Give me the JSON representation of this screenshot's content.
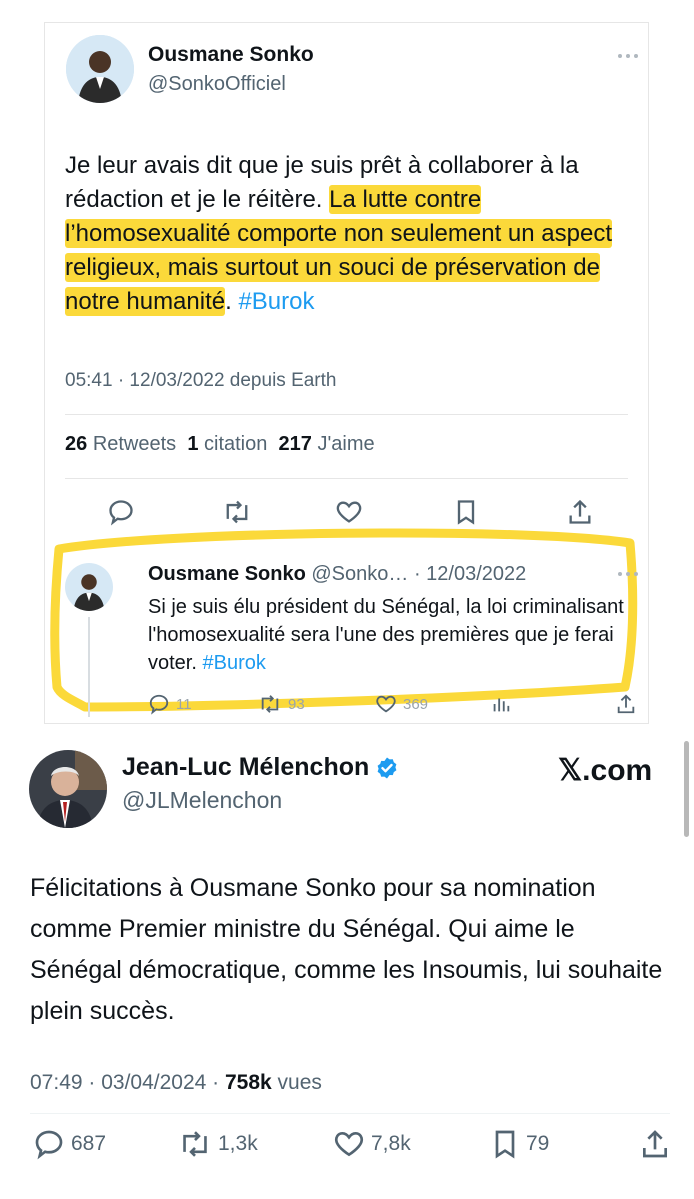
{
  "tweet1": {
    "author_name": "Ousmane Sonko",
    "author_handle": "@SonkoOfficiel",
    "text_part1": "Je leur avais dit que je suis prêt à collaborer à la rédaction et je le réitère. ",
    "text_highlight": "La lutte contre l’homosexualité comporte non seulement un aspect religieux, mais surtout un souci de préservation de notre humanité",
    "text_end": ". ",
    "hashtag": "#Burok",
    "timestamp": "05:41 · 12/03/2022 depuis Earth",
    "retweets_count": "26",
    "retweets_label": "Retweets",
    "quotes_count": "1",
    "quotes_label": "citation",
    "likes_count": "217",
    "likes_label": "J'aime"
  },
  "quoted_tweet": {
    "author_name": "Ousmane Sonko",
    "meta": "@Sonko… · 12/03/2022",
    "text": "Si je suis élu président du Sénégal, la loi criminalisant l'homosexualité sera l'une des premières que je ferai voter. ",
    "hashtag": "#Burok",
    "replies": "11",
    "retweets": "93",
    "likes": "369"
  },
  "tweet2": {
    "author_name": "Jean-Luc Mélenchon",
    "author_handle": "@JLMelenchon",
    "brand": "𝕏.com",
    "text": "Félicitations à Ousmane Sonko pour sa nomination comme Premier ministre du Sénégal. Qui aime le Sénégal démocratique, comme les Insoumis, lui souhaite plein succès.",
    "timestamp": "07:49 · 03/04/2024 · ",
    "views_count": "758k",
    "views_label": " vues",
    "replies": "687",
    "retweets": "1,3k",
    "likes": "7,8k",
    "bookmarks": "79"
  },
  "colors": {
    "highlight": "#fbd93a",
    "link": "#1d9bf0",
    "muted": "#536471",
    "verified": "#1d9bf0"
  }
}
